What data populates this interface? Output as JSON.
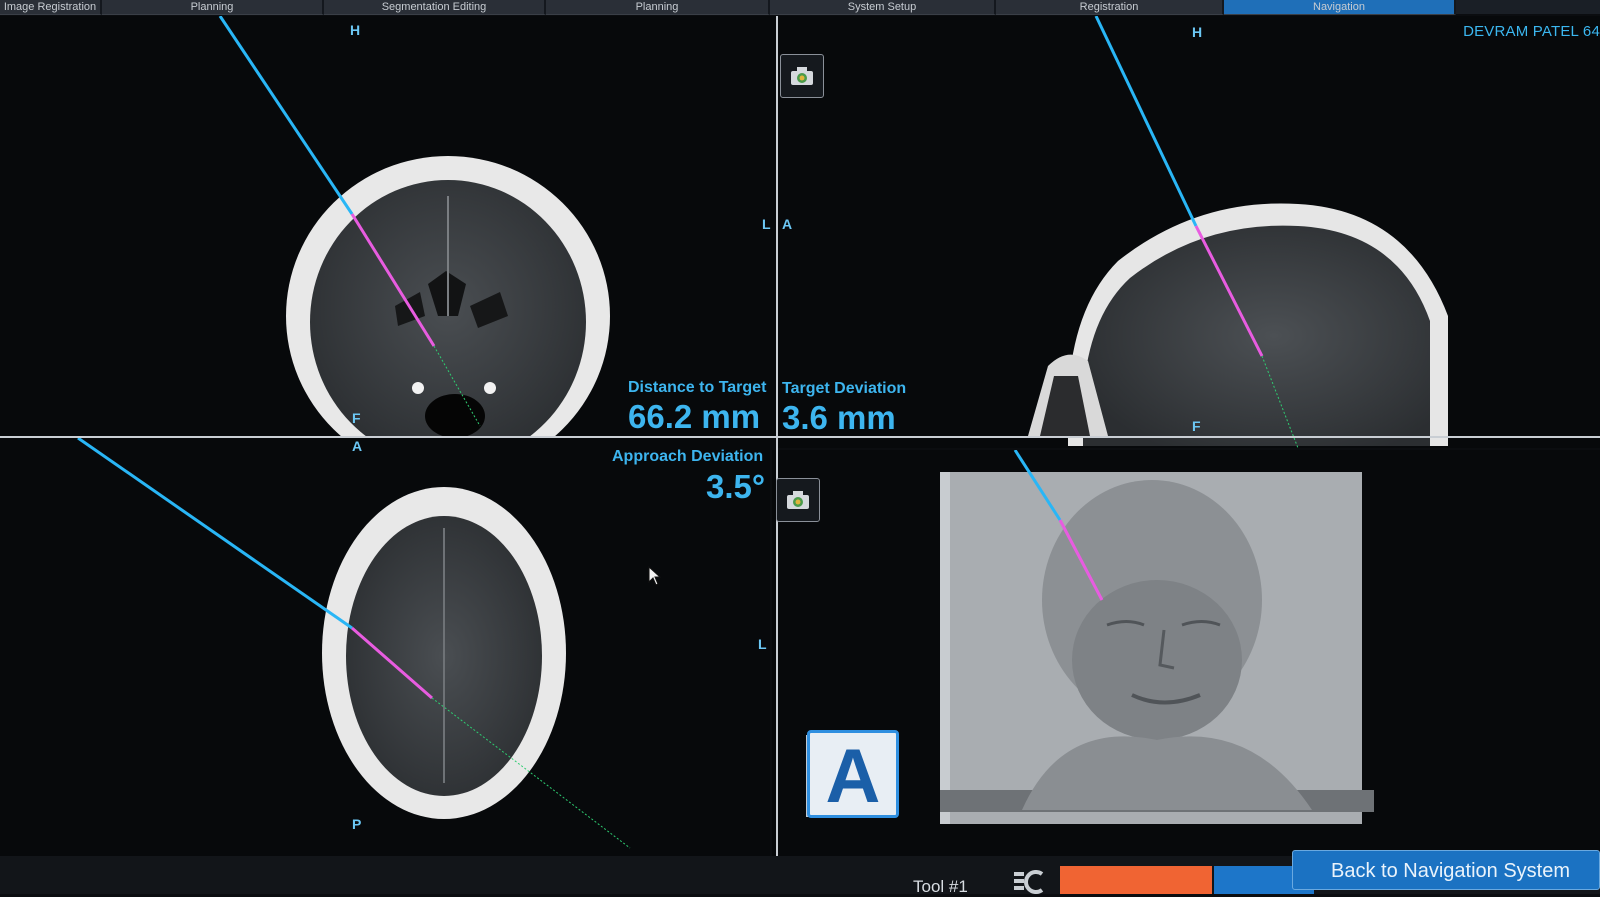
{
  "tabs": [
    {
      "label": "Image Registration"
    },
    {
      "label": "Planning"
    },
    {
      "label": "Segmentation Editing"
    },
    {
      "label": "Planning"
    },
    {
      "label": "System Setup"
    },
    {
      "label": "Registration"
    },
    {
      "label": "Navigation"
    }
  ],
  "patient_name": "DEVRAM PATEL 64",
  "views": {
    "coronal": {
      "top": "H",
      "bottom": "F",
      "right": "L"
    },
    "sagittal": {
      "top": "H",
      "bottom": "F",
      "left": "A"
    },
    "axial": {
      "top": "A",
      "bottom": "P",
      "right": "L"
    }
  },
  "metrics": {
    "distance_label": "Distance to Target",
    "distance_value": "66.2 mm",
    "target_dev_label": "Target Deviation",
    "target_dev_value": "3.6 mm",
    "approach_dev_label": "Approach Deviation",
    "approach_dev_value": "3.5°"
  },
  "icons": {
    "camera": "camera-icon",
    "orientation_cube": "orientation-cube-icon",
    "tool": "tool-icon"
  },
  "orientation_cube_letter": "A",
  "bottom": {
    "tool_label": "Tool #1",
    "back_button": "Back to Navigation System"
  },
  "colors": {
    "accent": "#3db5ef",
    "trajectory_outer": "#29b6f6",
    "trajectory_inner": "#e85ce0",
    "orange_button": "#f06433",
    "blue_button": "#1d76c9"
  }
}
